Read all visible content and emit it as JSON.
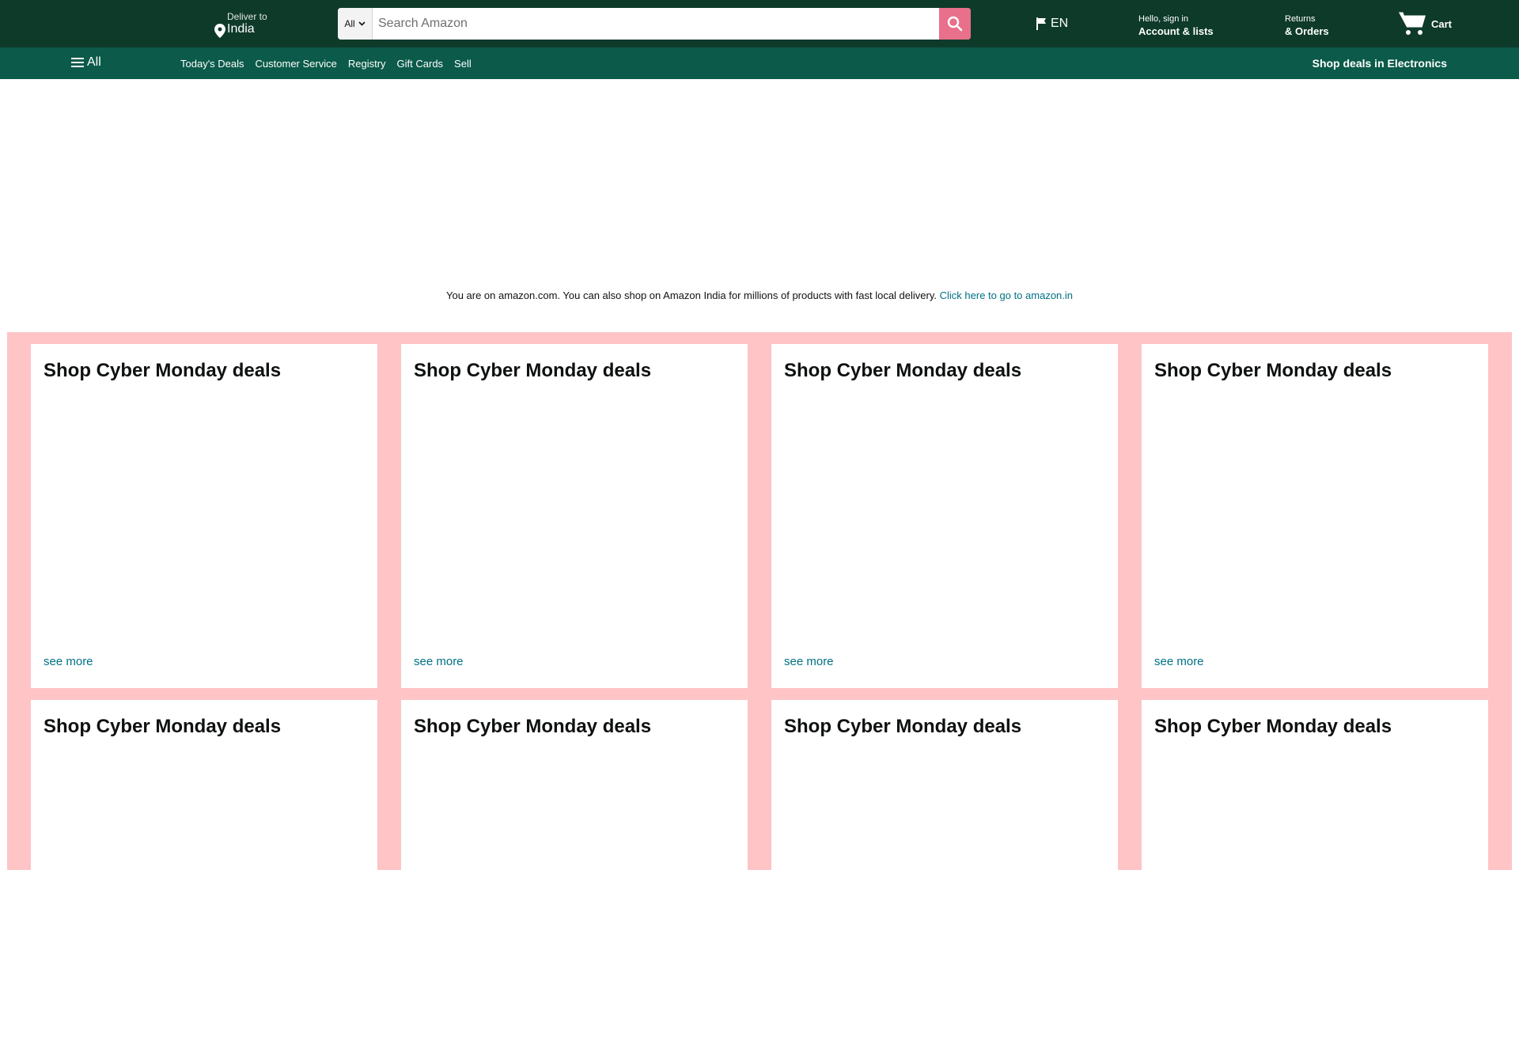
{
  "header": {
    "deliver_small": "Deliver to",
    "deliver_location": "India",
    "search_category": "All",
    "search_placeholder": "Search Amazon",
    "language": "EN",
    "account_small": "Hello, sign in",
    "account_big": "Account & lists",
    "returns_small": "Returns",
    "returns_big": "& Orders",
    "cart_label": "Cart",
    "colors": {
      "topbar": "#0e3a2a",
      "subnav": "#0b5a4a",
      "search_button": "#e8708a"
    }
  },
  "subnav": {
    "all_label": "All",
    "links": [
      "Today's Deals",
      "Customer Service",
      "Registry",
      "Gift Cards",
      "Sell"
    ],
    "promo": "Shop deals in Electronics"
  },
  "notice": {
    "text": "You are on amazon.com. You can also shop on Amazon India for millions of products with fast local delivery.",
    "link": "Click here to go to amazon.in"
  },
  "deals": {
    "background": "#fec4c6",
    "cards": [
      {
        "title": "Shop Cyber Monday deals",
        "link": "see more"
      },
      {
        "title": "Shop Cyber Monday deals",
        "link": "see more"
      },
      {
        "title": "Shop Cyber Monday deals",
        "link": "see more"
      },
      {
        "title": "Shop Cyber Monday deals",
        "link": "see more"
      },
      {
        "title": "Shop Cyber Monday deals",
        "link": ""
      },
      {
        "title": "Shop Cyber Monday deals",
        "link": ""
      },
      {
        "title": "Shop Cyber Monday deals",
        "link": ""
      },
      {
        "title": "Shop Cyber Monday deals",
        "link": ""
      }
    ]
  }
}
